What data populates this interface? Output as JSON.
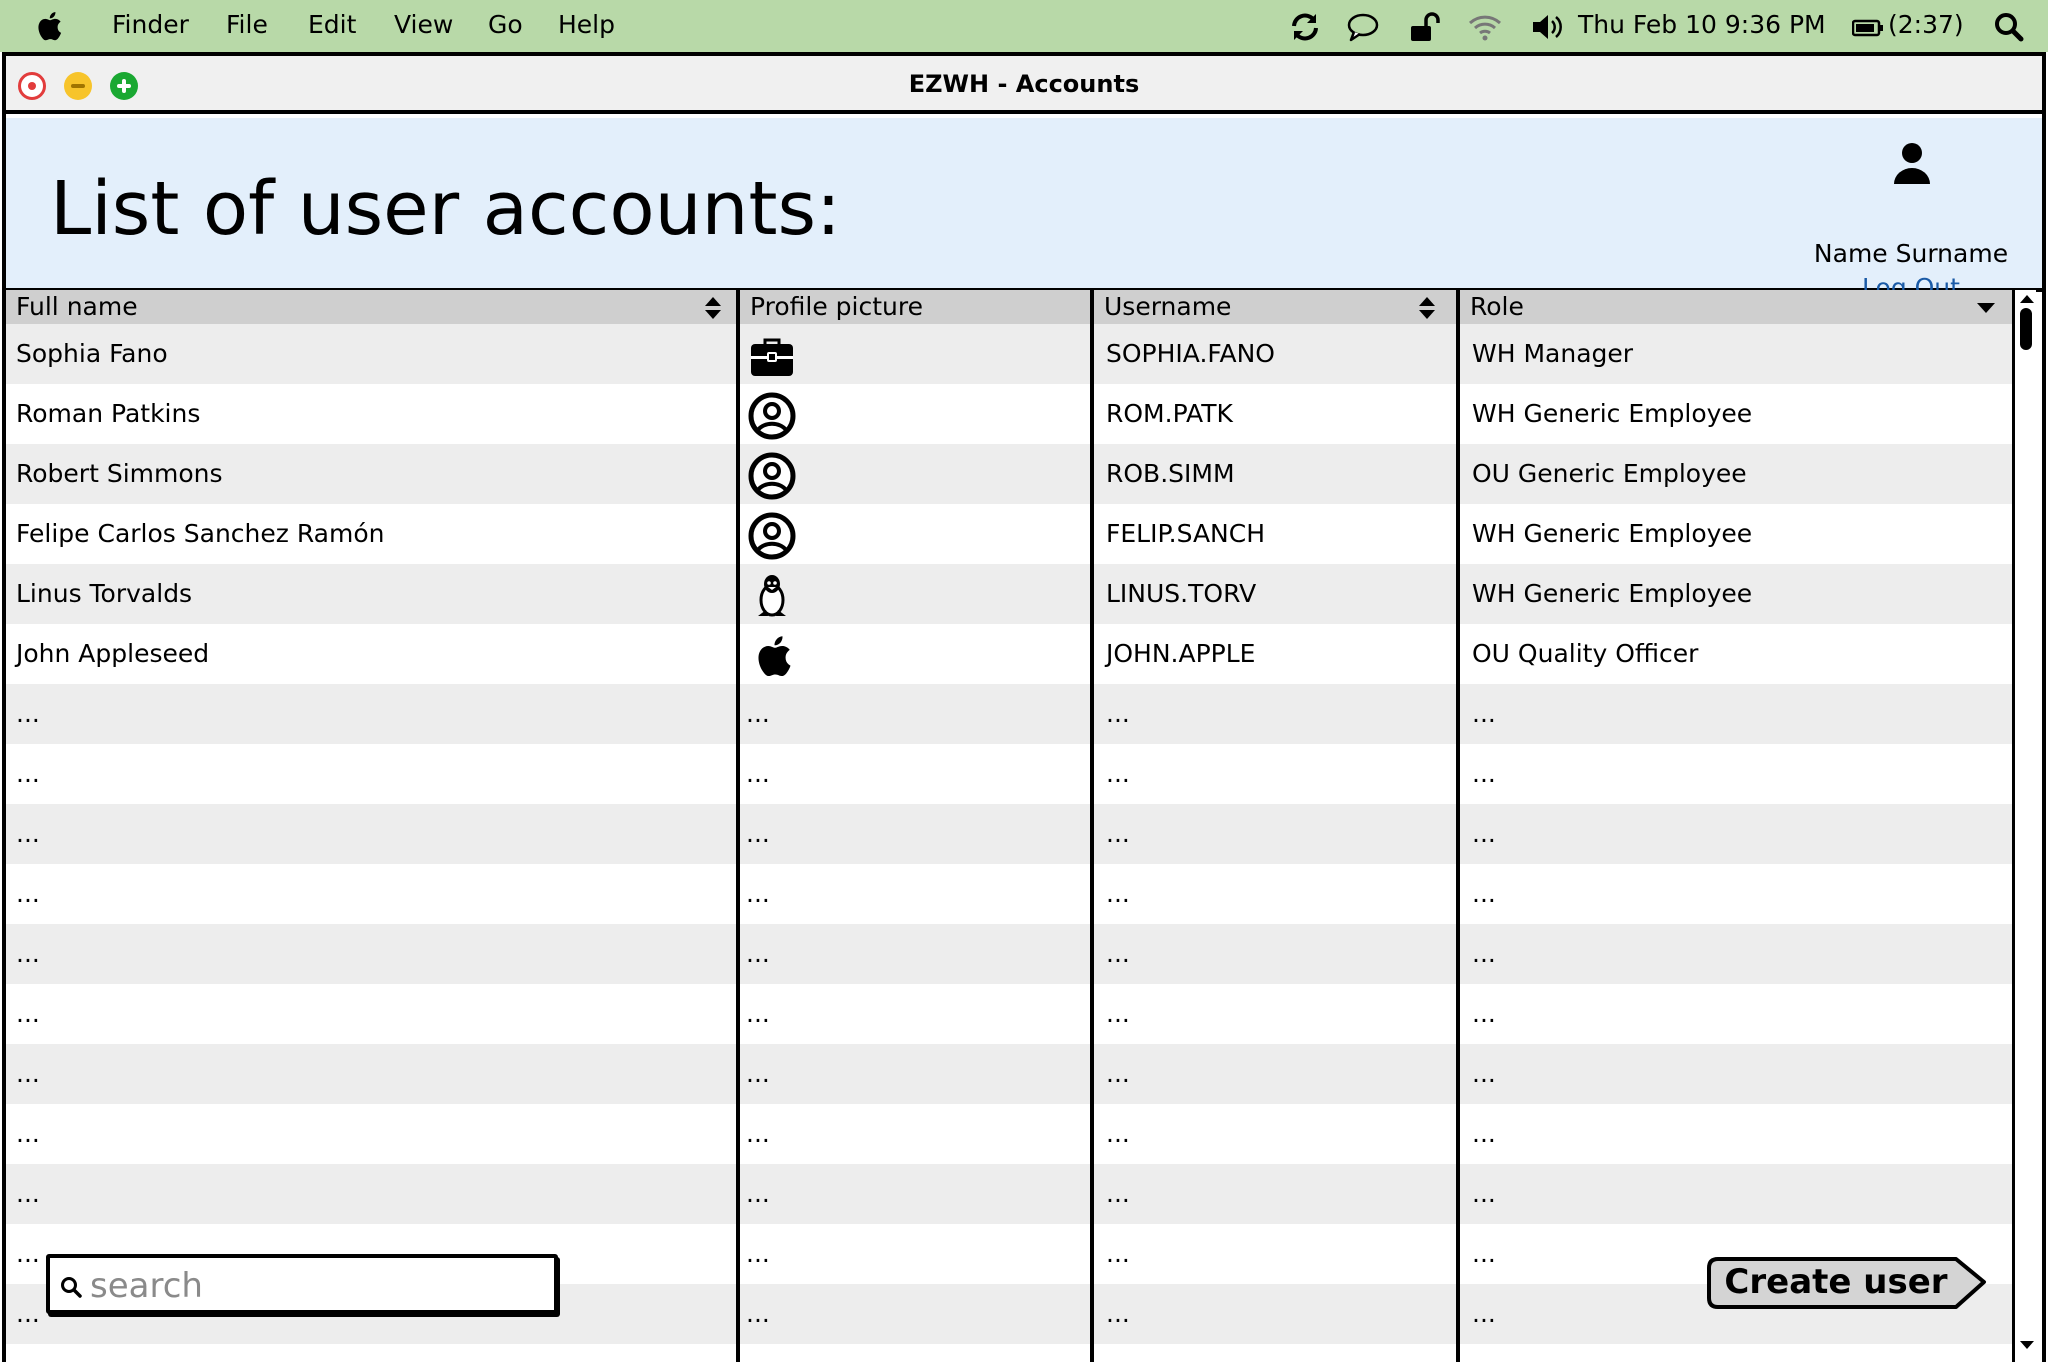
{
  "menubar": {
    "apple_icon": "apple-icon",
    "items": [
      "Finder",
      "File",
      "Edit",
      "View",
      "Go",
      "Help"
    ],
    "status_icons": [
      "sync-icon",
      "chat-bubble-icon",
      "unlock-icon",
      "wifi-icon",
      "volume-icon"
    ],
    "clock": "Thu Feb 10  9:36 PM",
    "battery_icon": "battery-icon",
    "battery": "(2:37)",
    "search_icon": "search-icon"
  },
  "window": {
    "title": "EZWH - Accounts"
  },
  "header": {
    "title": "List of user accounts:",
    "user_name": "Name Surname",
    "logout_label": "Log Out"
  },
  "table": {
    "columns": [
      "Full name",
      "Profile picture",
      "Username",
      "Role"
    ],
    "rows": [
      {
        "full_name": "Sophia Fano",
        "picture": "briefcase-icon",
        "username": "SOPHIA.FANO",
        "role": "WH Manager"
      },
      {
        "full_name": "Roman Patkins",
        "picture": "user-circle-icon",
        "username": "ROM.PATK",
        "role": "WH Generic Employee"
      },
      {
        "full_name": "Robert Simmons",
        "picture": "user-circle-icon",
        "username": "ROB.SIMM",
        "role": "OU Generic Employee"
      },
      {
        "full_name": "Felipe Carlos Sanchez Ramón",
        "picture": "user-circle-icon",
        "username": "FELIP.SANCH",
        "role": "WH Generic Employee"
      },
      {
        "full_name": "Linus Torvalds",
        "picture": "linux-penguin-icon",
        "username": "LINUS.TORV",
        "role": "WH Generic Employee"
      },
      {
        "full_name": "John Appleseed",
        "picture": "apple-icon",
        "username": "JOHN.APPLE",
        "role": "OU Quality Officer"
      },
      {
        "full_name": "...",
        "picture": "...",
        "username": "...",
        "role": "..."
      },
      {
        "full_name": "...",
        "picture": "...",
        "username": "...",
        "role": "..."
      },
      {
        "full_name": "...",
        "picture": "...",
        "username": "...",
        "role": "..."
      },
      {
        "full_name": "...",
        "picture": "...",
        "username": "...",
        "role": "..."
      },
      {
        "full_name": "...",
        "picture": "...",
        "username": "...",
        "role": "..."
      },
      {
        "full_name": "...",
        "picture": "...",
        "username": "...",
        "role": "..."
      },
      {
        "full_name": "...",
        "picture": "...",
        "username": "...",
        "role": "..."
      },
      {
        "full_name": "...",
        "picture": "...",
        "username": "...",
        "role": "..."
      },
      {
        "full_name": "...",
        "picture": "...",
        "username": "...",
        "role": "..."
      },
      {
        "full_name": "...",
        "picture": "...",
        "username": "...",
        "role": "..."
      },
      {
        "full_name": "...",
        "picture": "...",
        "username": "...",
        "role": "..."
      }
    ]
  },
  "search": {
    "placeholder": "search",
    "value": ""
  },
  "actions": {
    "create_user_label": "Create user"
  },
  "colors": {
    "menubar": "#b8d9a8",
    "header_bg": "#e3effb",
    "table_header_bg": "#cfcfcf",
    "row_alt_bg": "#ededed",
    "link": "#1a5aa6",
    "button_bg": "#d4d4d4"
  }
}
